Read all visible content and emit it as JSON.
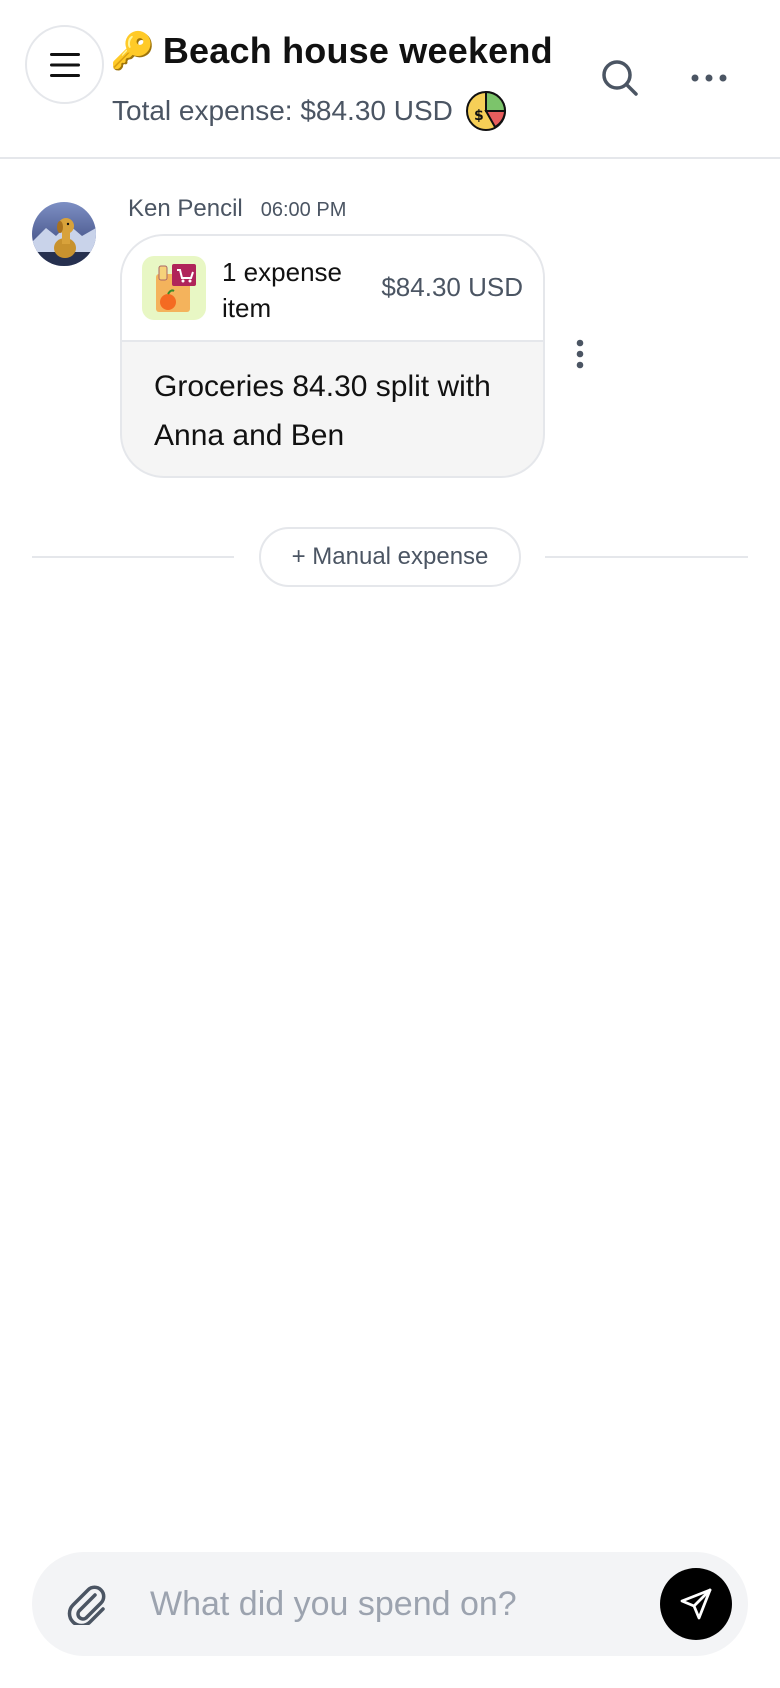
{
  "header": {
    "title_emoji": "🔑",
    "title": "Beach house weekend",
    "subtitle": "Total expense: $84.30 USD",
    "icons": {
      "menu": "hamburger-menu-icon",
      "search": "search-icon",
      "more": "more-horizontal-icon",
      "pie": "pie-chart-money-icon"
    }
  },
  "message": {
    "sender": "Ken Pencil",
    "time": "06:00 PM",
    "card": {
      "count_label": "1 expense item",
      "amount": "$84.30 USD",
      "icon": "grocery-bag-icon"
    },
    "text": "Groceries 84.30 split with Anna and Ben"
  },
  "actions": {
    "manual_expense_label": "+ Manual expense"
  },
  "composer": {
    "placeholder": "What did you spend on?",
    "value": ""
  },
  "colors": {
    "accent": "#000000",
    "muted_text": "#4b5563",
    "border": "#e5e7eb",
    "bubble_bg": "#f5f5f5"
  }
}
